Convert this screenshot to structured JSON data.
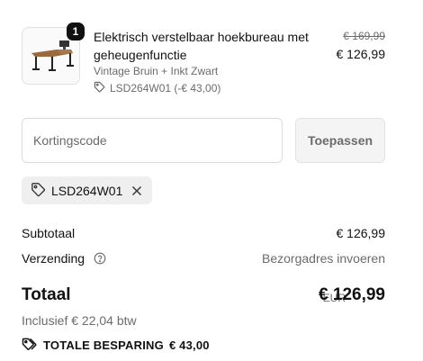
{
  "product": {
    "quantity": "1",
    "title": "Elektrisch verstelbaar hoekbureau met geheugenfunctie",
    "variant": "Vintage Bruin + Inkt Zwart",
    "discount": "LSD264W01 (-€ 43,00)",
    "original_price": "€ 169,99",
    "price": "€ 126,99",
    "image": "corner-desk-thumbnail"
  },
  "discount_form": {
    "placeholder": "Kortingscode",
    "value": "",
    "apply_label": "Toepassen"
  },
  "applied_code": {
    "code": "LSD264W01",
    "icon": "tag-icon",
    "remove_icon": "close-icon"
  },
  "summary": {
    "subtotal_label": "Subtotaal",
    "subtotal_value": "€ 126,99",
    "shipping_label": "Verzending",
    "shipping_value": "Bezorgadres invoeren",
    "total_label": "Totaal",
    "currency": "EUR",
    "total_value": "€ 126,99",
    "tax_note": "Inclusief € 22,04 btw",
    "savings_label": "TOTALE BESPARING",
    "savings_value": "€ 43,00"
  },
  "colors": {
    "text": "#111111",
    "muted": "#6b6b6b",
    "border": "#dcdcdc",
    "chip_bg": "#efefef",
    "badge_bg": "#111111"
  }
}
